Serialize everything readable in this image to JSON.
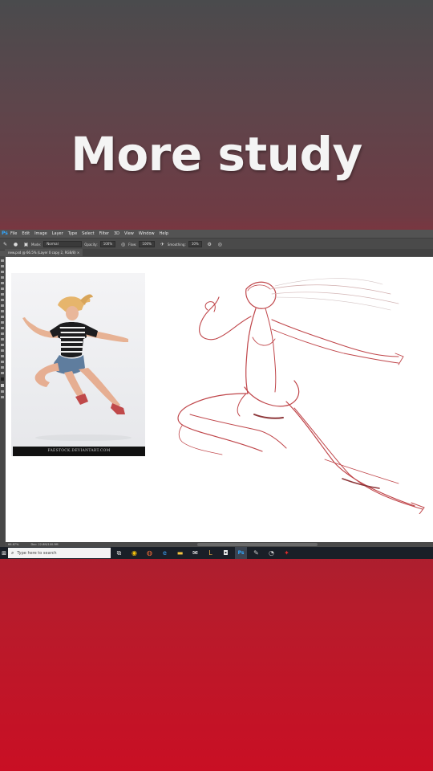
{
  "caption": "More study",
  "menu": [
    "File",
    "Edit",
    "Image",
    "Layer",
    "Type",
    "Select",
    "Filter",
    "3D",
    "View",
    "Window",
    "Help"
  ],
  "options": {
    "mode_label": "Mode:",
    "mode_value": "Normal",
    "opacity_label": "Opacity:",
    "opacity_value": "100%",
    "flow_label": "Flow:",
    "flow_value": "100%",
    "smoothing_label": "Smoothing:",
    "smoothing_value": "10%"
  },
  "document_tab": "new.psd @ 66.5% (Layer 0 copy 2, RGB/8) ×",
  "reference_credit": "FAESTOCK.DEVIANTART.COM",
  "status": {
    "zoom": "66.67%",
    "doc": "Doc: 22.8M/100.9M"
  },
  "taskbar": {
    "search_placeholder": "Type here to search",
    "apps": [
      "task-view",
      "chrome",
      "firefox",
      "edge",
      "file-explorer",
      "mail",
      "store",
      "camera",
      "photoshop",
      "paint",
      "clock",
      "acrobat"
    ]
  },
  "colors": {
    "sketch_stroke": "#b5262b",
    "ps_ui": "#535353",
    "taskbar": "#1a1f27"
  }
}
